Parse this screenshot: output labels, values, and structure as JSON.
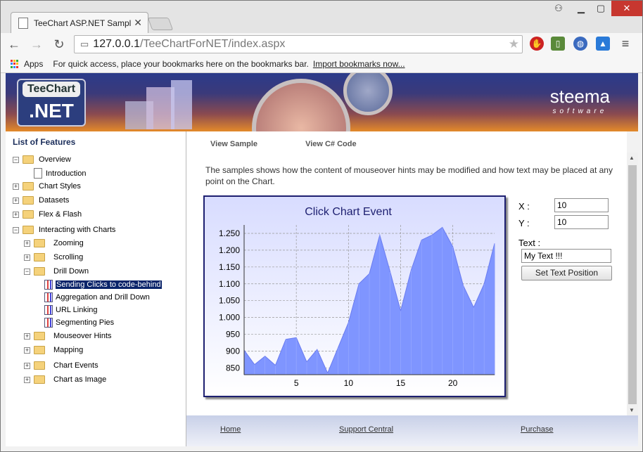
{
  "browser": {
    "tab_title": "TeeChart ASP.NET Sample",
    "url_host": "127.0.0.1",
    "url_path": "/TeeChartForNET/index.aspx",
    "bookmarks_apps": "Apps",
    "bookmarks_hint": "For quick access, place your bookmarks here on the bookmarks bar.",
    "bookmarks_import": "Import bookmarks now..."
  },
  "banner": {
    "logo_top": "TeeChart",
    "logo_bottom": ".NET",
    "brand": "steema",
    "brand_sub": "software"
  },
  "sidebar": {
    "title": "List of Features",
    "items": [
      {
        "label": "Overview"
      },
      {
        "label": "Introduction"
      },
      {
        "label": "Chart Styles"
      },
      {
        "label": "Datasets"
      },
      {
        "label": "Flex & Flash"
      },
      {
        "label": "Interacting with Charts"
      },
      {
        "label": "Zooming"
      },
      {
        "label": "Scrolling"
      },
      {
        "label": "Drill Down"
      },
      {
        "label": "Sending Clicks to code-behind"
      },
      {
        "label": "Aggregation and Drill Down"
      },
      {
        "label": "URL Linking"
      },
      {
        "label": "Segmenting Pies"
      },
      {
        "label": "Mouseover Hints"
      },
      {
        "label": "Mapping"
      },
      {
        "label": "Chart Events"
      },
      {
        "label": "Chart as Image"
      }
    ]
  },
  "main": {
    "tab_view_sample": "View Sample",
    "tab_view_code": "View C# Code",
    "description": "The samples shows how the content of mouseover hints may be modified and how text may be placed at any point on the Chart.",
    "x_label": "X :",
    "y_label": "Y :",
    "x_value": "10",
    "y_value": "10",
    "text_label": "Text :",
    "text_value": "My Text !!!",
    "set_button": "Set Text Position"
  },
  "chart_data": {
    "type": "area",
    "title": "Click Chart Event",
    "x": [
      1,
      2,
      3,
      4,
      5,
      6,
      7,
      8,
      9,
      10,
      11,
      12,
      13,
      14,
      15,
      16,
      17,
      18,
      19,
      20,
      21,
      22,
      23,
      24
    ],
    "values": [
      903,
      860,
      885,
      858,
      935,
      940,
      868,
      905,
      835,
      910,
      985,
      1100,
      1130,
      1245,
      1135,
      1020,
      1140,
      1230,
      1245,
      1268,
      1210,
      1095,
      1030,
      1100,
      1220
    ],
    "x_ticks": [
      5,
      10,
      15,
      20
    ],
    "y_ticks": [
      850,
      900,
      950,
      1000,
      1050,
      1100,
      1150,
      1200,
      1250
    ],
    "y_tick_labels": [
      "850",
      "900",
      "950",
      "1.000",
      "1.050",
      "1.100",
      "1.150",
      "1.200",
      "1.250"
    ],
    "ylim": [
      830,
      1275
    ],
    "xlim": [
      0,
      24
    ],
    "grid": true,
    "color": "#7f95ff"
  },
  "footer": {
    "home": "Home",
    "support": "Support Central",
    "purchase": "Purchase"
  }
}
